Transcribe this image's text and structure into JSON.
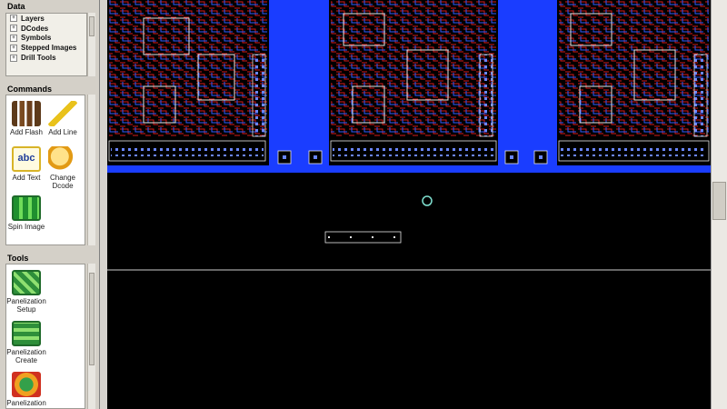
{
  "data_panel": {
    "title": "Data",
    "items": [
      {
        "label": "Layers"
      },
      {
        "label": "DCodes"
      },
      {
        "label": "Symbols"
      },
      {
        "label": "Stepped Images"
      },
      {
        "label": "Drill Tools"
      }
    ]
  },
  "commands_panel": {
    "title": "Commands",
    "tools": [
      {
        "label": "Add Flash",
        "icon": "add-flash-icon"
      },
      {
        "label": "Add Line",
        "icon": "add-line-icon"
      },
      {
        "label": "Add Text",
        "icon": "add-text-icon"
      },
      {
        "label": "Change Dcode",
        "icon": "change-dcode-icon"
      },
      {
        "label": "Spin Image",
        "icon": "spin-image-icon"
      }
    ]
  },
  "tools_panel": {
    "title": "Tools",
    "tools": [
      {
        "label": "Panelization Setup",
        "icon": "panelization-setup-icon"
      },
      {
        "label": "Panelization Create",
        "icon": "panelization-create-icon"
      },
      {
        "label": "Panelization",
        "icon": "panelization-icon"
      }
    ]
  },
  "colors": {
    "canvas_bg": "#000000",
    "board_outline": "#1a3dff",
    "trace_red": "#d31a1a",
    "trace_blue": "#2a5cff",
    "silk_white": "#e6e6e6"
  }
}
